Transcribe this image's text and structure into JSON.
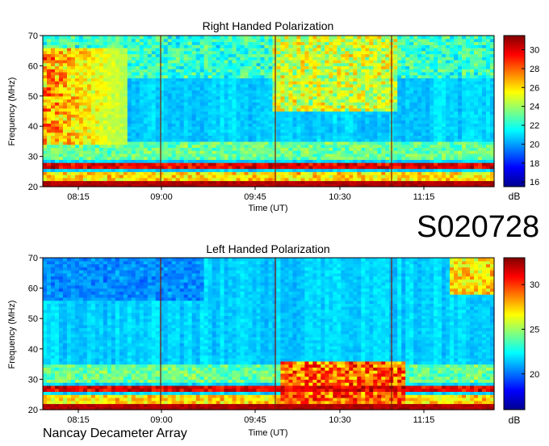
{
  "figure_id": "S020728",
  "footer": "Nancay Decameter Array",
  "chart_data": [
    {
      "type": "heatmap",
      "title": "Right Handed Polarization",
      "xlabel": "Time (UT)",
      "ylabel": "Frequency (MHz)",
      "x_ticks": [
        "08:15",
        "09:00",
        "09:45",
        "10:30",
        "11:15"
      ],
      "y_ticks": [
        20,
        30,
        40,
        50,
        60,
        70
      ],
      "ylim": [
        20,
        70
      ],
      "colorbar": {
        "label": "dB",
        "ticks": [
          16,
          18,
          20,
          22,
          24,
          26,
          28,
          30
        ],
        "range": [
          15.5,
          31.5
        ]
      },
      "colormap": "jet",
      "noted_features": [
        "Strong emission bands near 21, 26-28 MHz across entire interval",
        "Narrow bright line near 41 MHz",
        "Burst activity 35-65 MHz around 08:00-08:30 UT",
        "Vertical striations between 09:45 and 11:15 UT"
      ]
    },
    {
      "type": "heatmap",
      "title": "Left Handed Polarization",
      "xlabel": "Time (UT)",
      "ylabel": "Frequency (MHz)",
      "x_ticks": [
        "08:15",
        "09:00",
        "09:45",
        "10:30",
        "11:15"
      ],
      "y_ticks": [
        20,
        30,
        40,
        50,
        60,
        70
      ],
      "ylim": [
        20,
        70
      ],
      "colorbar": {
        "label": "dB",
        "ticks": [
          20,
          25,
          30
        ],
        "range": [
          16,
          33
        ]
      },
      "colormap": "jet",
      "noted_features": [
        "Strong emission bands near 21, 26-28 MHz across entire interval",
        "Elevated levels 25-35 MHz from 09:45 to 11:15 UT",
        "Lines near 41 and 48 MHz"
      ]
    }
  ]
}
